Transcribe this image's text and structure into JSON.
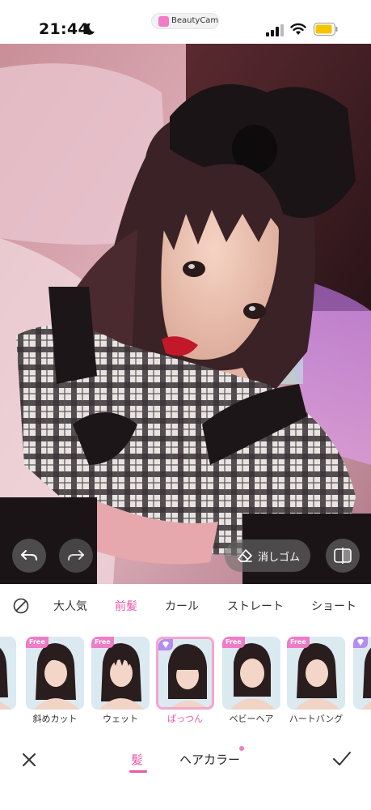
{
  "status_bar": {
    "time": "21:44",
    "app_name": "BeautyCam",
    "battery_color": "#f5c400"
  },
  "photo": {
    "description_icon": "portrait-photo"
  },
  "photo_controls": {
    "eraser_label": "消しゴム"
  },
  "categories": {
    "items": [
      "大人気",
      "前髪",
      "カール",
      "ストレート",
      "ショート"
    ],
    "active": "前髪"
  },
  "styles": [
    {
      "label": "チ",
      "badge": ""
    },
    {
      "label": "斜めカット",
      "badge": "Free"
    },
    {
      "label": "ウェット",
      "badge": "Free"
    },
    {
      "label": "ぱっつん",
      "badge": "vip",
      "selected": true
    },
    {
      "label": "ベビーヘア",
      "badge": "Free"
    },
    {
      "label": "ハートバング",
      "badge": "Free"
    },
    {
      "label": "",
      "badge": "vip"
    }
  ],
  "bottom_bar": {
    "tab_hair": "髪",
    "tab_color": "ヘアカラー"
  },
  "colors": {
    "accent": "#e85aa8",
    "free_badge": "#f07bc7",
    "vip_badge": "#b58cf0"
  }
}
